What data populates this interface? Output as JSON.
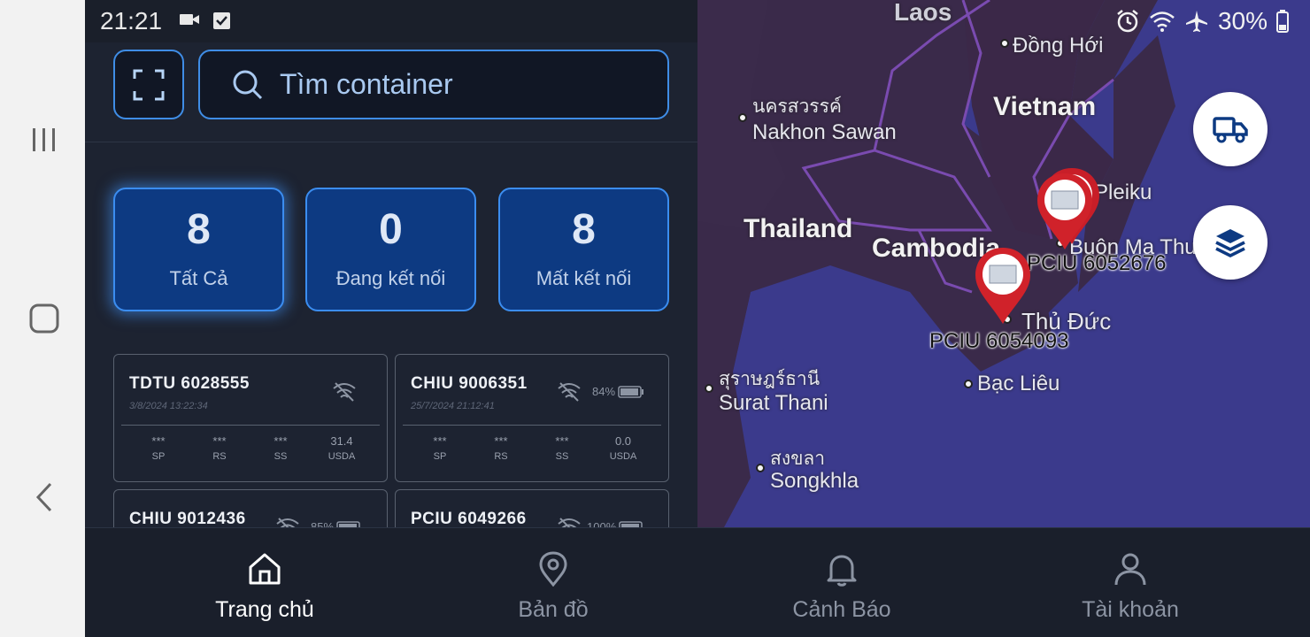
{
  "status": {
    "time": "21:21",
    "battery": "30%"
  },
  "search": {
    "placeholder": "Tìm container"
  },
  "stats": [
    {
      "value": "8",
      "label": "Tất Cả"
    },
    {
      "value": "0",
      "label": "Đang kết nối"
    },
    {
      "value": "8",
      "label": "Mất kết nối"
    }
  ],
  "cards": [
    {
      "id": "TDTU 6028555",
      "time": "3/8/2024 13:22:34",
      "battery": "",
      "metrics": [
        {
          "v": "***",
          "l": "SP"
        },
        {
          "v": "***",
          "l": "RS"
        },
        {
          "v": "***",
          "l": "SS"
        },
        {
          "v": "31.4",
          "l": "USDA"
        }
      ]
    },
    {
      "id": "CHIU 9006351",
      "time": "25/7/2024 21:12:41",
      "battery": "84%",
      "metrics": [
        {
          "v": "***",
          "l": "SP"
        },
        {
          "v": "***",
          "l": "RS"
        },
        {
          "v": "***",
          "l": "SS"
        },
        {
          "v": "0.0",
          "l": "USDA"
        }
      ]
    },
    {
      "id": "CHIU 9012436",
      "time": "",
      "battery": "85%"
    },
    {
      "id": "PCIU 6049266",
      "time": "",
      "battery": "100%"
    }
  ],
  "map": {
    "labels": {
      "laos": "Laos",
      "dong_hoi": "Đồng Hới",
      "nakhon_thai": "นครสวรรค์",
      "nakhon": "Nakhon Sawan",
      "vietnam": "Vietnam",
      "thailand": "Thailand",
      "cambodia": "Cambodia",
      "pleiku": "Pleiku",
      "buon": "Buôn Ma Thuột",
      "thu_duc": "Thủ Đức",
      "surat_thai": "สุราษฎร์ธานี",
      "surat": "Surat Thani",
      "bac_lieu": "Bạc Liêu",
      "songkhla_thai": "สงขลา",
      "songkhla": "Songkhla"
    },
    "markers": [
      {
        "label": "PCIU 6052676"
      },
      {
        "label": "PCIU 6054093"
      }
    ]
  },
  "bottom_nav": [
    {
      "label": "Trang chủ",
      "icon": "home-icon",
      "active": true
    },
    {
      "label": "Bản đồ",
      "icon": "map-pin-icon",
      "active": false
    },
    {
      "label": "Cảnh Báo",
      "icon": "bell-icon",
      "active": false
    },
    {
      "label": "Tài khoản",
      "icon": "user-icon",
      "active": false
    }
  ],
  "colors": {
    "accent": "#3f8de6",
    "stat_bg": "#0d3a82",
    "panel_bg": "#1d2331",
    "map_bg": "#3b3a8c",
    "marker": "#d0222a"
  }
}
